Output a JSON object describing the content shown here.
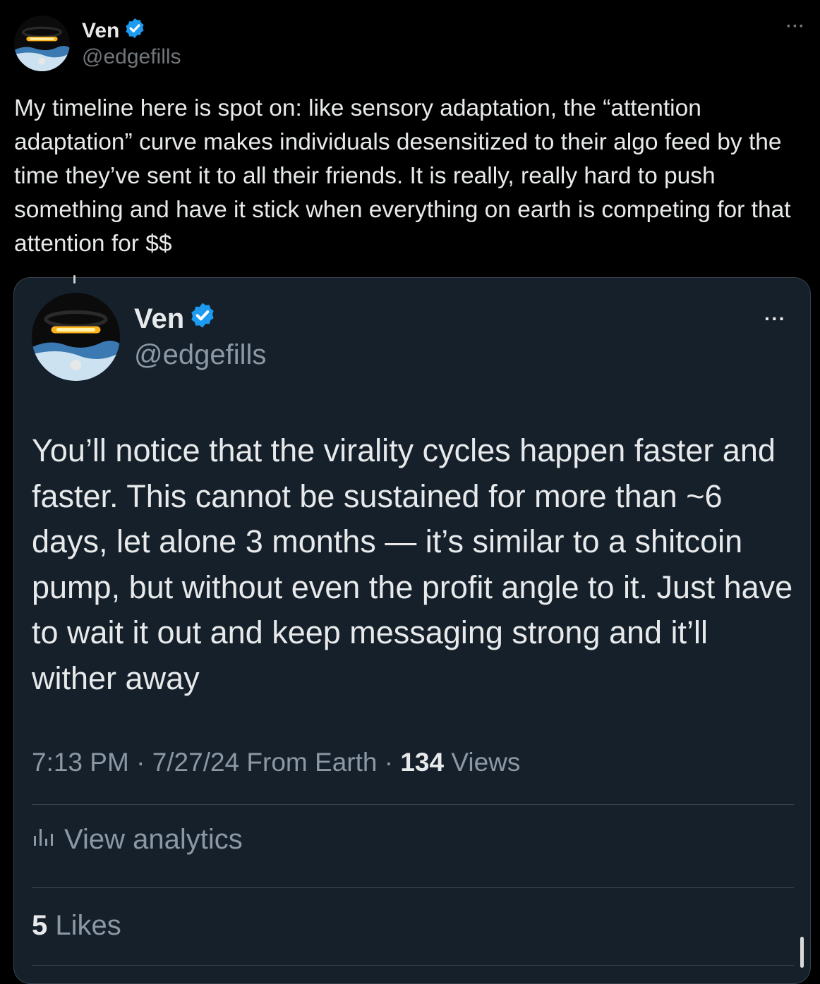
{
  "outer_tweet": {
    "author_name": "Ven",
    "author_handle": "@edgefills",
    "text": "My timeline here is spot on: like sensory adaptation, the “attention adaptation” curve makes individuals desensitized to their algo feed by the time they’ve sent it to all their friends. It is really, really hard to push something and have it stick when everything on earth is competing for that attention for $$",
    "more_icon": "ellipsis-icon",
    "more_label": "···"
  },
  "quoted_tweet": {
    "author_name": "Ven",
    "author_handle": "@edgefills",
    "more_label": "···",
    "text": "You’ll notice that the virality cycles happen faster and faster. This cannot be sustained for more than ~6 days, let alone 3 months — it’s similar to a shitcoin pump, but without even the profit angle to it. Just have to wait it out and keep messaging strong and it’ll wither away",
    "time": "7:13 PM",
    "separator": " · ",
    "date": "7/27/24",
    "location": " From Earth",
    "views_count": "134",
    "views_label": " Views",
    "analytics_label": "View analytics",
    "likes_count": "5",
    "likes_label": " Likes"
  },
  "colors": {
    "background": "#000000",
    "card_background": "#15202b",
    "verified": "#1d9bf0",
    "muted_text": "#71767b"
  }
}
